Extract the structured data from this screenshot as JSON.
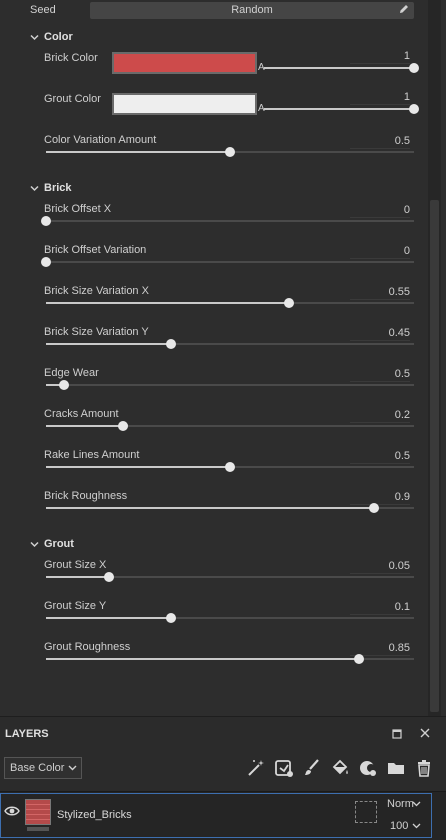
{
  "seed": {
    "label": "Seed",
    "value": "Random"
  },
  "sections": {
    "color": {
      "title": "Color"
    },
    "brick": {
      "title": "Brick"
    },
    "grout": {
      "title": "Grout"
    }
  },
  "color_params": {
    "brick_color": {
      "label": "Brick Color",
      "swatch": "#cd4b4b",
      "alpha_label": "A",
      "alpha_value": "1",
      "alpha_fraction": 1.0
    },
    "grout_color": {
      "label": "Grout Color",
      "swatch": "#eeeeee",
      "alpha_label": "A",
      "alpha_value": "1",
      "alpha_fraction": 1.0
    }
  },
  "params": {
    "color_variation": {
      "label": "Color Variation Amount",
      "value": "0.5",
      "fraction": 0.5
    },
    "brick_offset_x": {
      "label": "Brick Offset X",
      "value": "0",
      "fraction": 0.0
    },
    "brick_offset_var": {
      "label": "Brick Offset Variation",
      "value": "0",
      "fraction": 0.0
    },
    "brick_size_var_x": {
      "label": "Brick Size Variation X",
      "value": "0.55",
      "fraction": 0.66
    },
    "brick_size_var_y": {
      "label": "Brick Size Variation Y",
      "value": "0.45",
      "fraction": 0.34
    },
    "edge_wear": {
      "label": "Edge Wear",
      "value": "0.5",
      "fraction": 0.05
    },
    "cracks_amount": {
      "label": "Cracks Amount",
      "value": "0.2",
      "fraction": 0.21
    },
    "rake_lines": {
      "label": "Rake Lines Amount",
      "value": "0.5",
      "fraction": 0.5
    },
    "brick_roughness": {
      "label": "Brick Roughness",
      "value": "0.9",
      "fraction": 0.89
    },
    "grout_size_x": {
      "label": "Grout Size X",
      "value": "0.05",
      "fraction": 0.17
    },
    "grout_size_y": {
      "label": "Grout Size Y",
      "value": "0.1",
      "fraction": 0.34
    },
    "grout_roughness": {
      "label": "Grout Roughness",
      "value": "0.85",
      "fraction": 0.85
    }
  },
  "layers": {
    "title": "LAYERS",
    "channel": "Base Color",
    "layer_name": "Stylized_Bricks",
    "blend_mode": "Norm",
    "opacity": "100"
  },
  "colors": {
    "accent": "#3d6fb0",
    "panel": "#2d2d2d"
  }
}
